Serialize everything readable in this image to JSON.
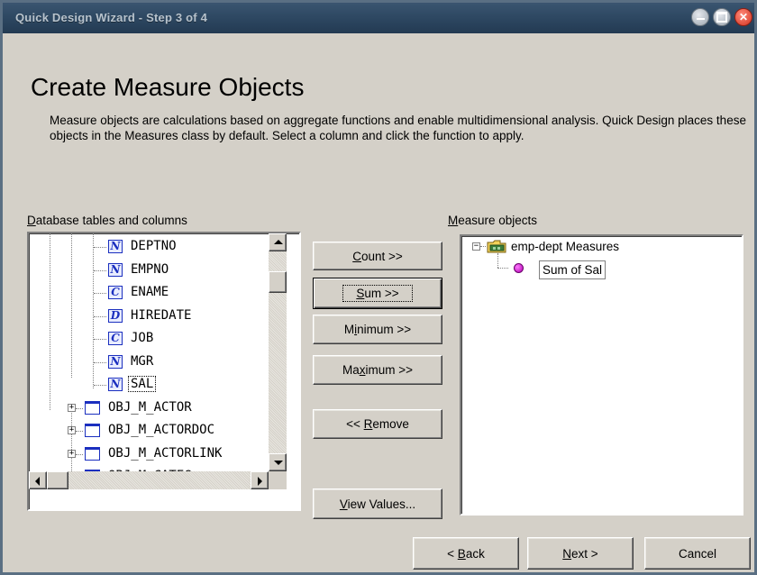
{
  "window": {
    "title": "Quick Design Wizard - Step 3 of 4"
  },
  "page": {
    "heading": "Create Measure Objects",
    "description": "Measure objects are calculations based on aggregate functions and enable multidimensional analysis. Quick Design places these objects in the Measures class by default. Select a column and click the function to apply."
  },
  "left_panel": {
    "label_mnemonic": "D",
    "label_rest": "atabase tables and columns",
    "columns": [
      {
        "type": "N",
        "name": "DEPTNO"
      },
      {
        "type": "N",
        "name": "EMPNO"
      },
      {
        "type": "C",
        "name": "ENAME"
      },
      {
        "type": "D",
        "name": "HIREDATE"
      },
      {
        "type": "C",
        "name": "JOB"
      },
      {
        "type": "N",
        "name": "MGR"
      },
      {
        "type": "N",
        "name": "SAL"
      }
    ],
    "tables": [
      {
        "name": "OBJ_M_ACTOR"
      },
      {
        "name": "OBJ_M_ACTORDOC"
      },
      {
        "name": "OBJ_M_ACTORLINK"
      },
      {
        "name": "OBJ_M_CATEG"
      }
    ]
  },
  "buttons": {
    "count": {
      "pre": "",
      "mn": "C",
      "post": "ount >>"
    },
    "sum": {
      "pre": "",
      "mn": "S",
      "post": "um >>"
    },
    "minimum": {
      "pre": "M",
      "mn": "i",
      "post": "nimum >>"
    },
    "maximum": {
      "pre": "Ma",
      "mn": "x",
      "post": "imum >>"
    },
    "remove": {
      "pre": "<< ",
      "mn": "R",
      "post": "emove"
    },
    "view_values": {
      "pre": "",
      "mn": "V",
      "post": "iew Values..."
    }
  },
  "right_panel": {
    "label_mnemonic": "M",
    "label_rest": "easure objects",
    "class_name": "emp-dept Measures",
    "measures": [
      "Sum of Sal"
    ]
  },
  "footer": {
    "back": {
      "pre": "< ",
      "mn": "B",
      "post": "ack"
    },
    "next": {
      "pre": "",
      "mn": "N",
      "post": "ext >"
    },
    "cancel": "Cancel"
  },
  "icons": {
    "close": "close-icon",
    "minimize": "minimize-icon",
    "maximize": "maximize-icon",
    "folder": "class-folder-icon",
    "measure": "measure-bullet-icon"
  }
}
